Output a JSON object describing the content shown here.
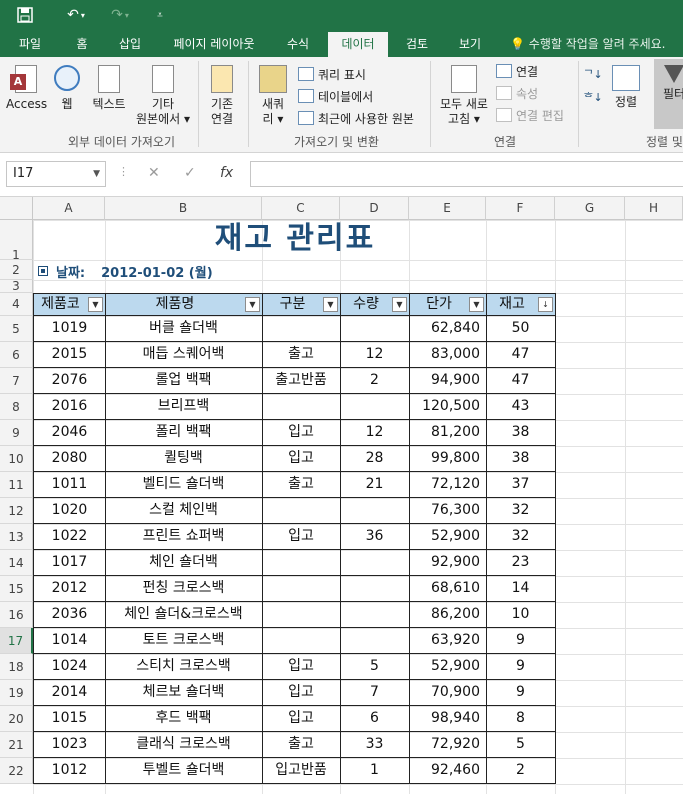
{
  "qat": {
    "save_icon": "save-icon",
    "undo_icon": "undo-icon",
    "redo_icon": "redo-icon",
    "customize_icon": "customize-qat-icon"
  },
  "tabs": [
    "파일",
    "홈",
    "삽입",
    "페이지 레이아웃",
    "수식",
    "데이터",
    "검토",
    "보기"
  ],
  "active_tab": "데이터",
  "tell_me": "수행할 작업을 알려 주세요.",
  "ribbon": {
    "external": {
      "access": "Access",
      "web": "웹",
      "text": "텍스트",
      "other_line1": "기타",
      "other_line2": "원본에서 ▾",
      "existing_line1": "기존",
      "existing_line2": "연결",
      "label": "외부 데이터 가져오기"
    },
    "get_transform": {
      "new_query_line1": "새쿼",
      "new_query_line2": "리 ▾",
      "show_queries": "쿼리 표시",
      "from_table": "테이블에서",
      "recent_sources": "최근에 사용한 원본",
      "label": "가져오기 및 변환"
    },
    "connections": {
      "refresh_line1": "모두 새로",
      "refresh_line2": "고침 ▾",
      "connections": "연결",
      "properties": "속성",
      "edit_links": "연결 편집",
      "label": "연결"
    },
    "sort_filter": {
      "sort": "정렬",
      "filter": "필터",
      "label": "정렬 및"
    }
  },
  "formula_bar": {
    "name_box": "I17",
    "fx": "fx",
    "value": ""
  },
  "columns": [
    "A",
    "B",
    "C",
    "D",
    "E",
    "F",
    "G",
    "H"
  ],
  "rows": [
    "1",
    "2",
    "3",
    "4",
    "5",
    "6",
    "7",
    "8",
    "9",
    "10",
    "11",
    "12",
    "13",
    "14",
    "15",
    "16",
    "17",
    "18",
    "19",
    "20",
    "21",
    "22"
  ],
  "selected_row": "17",
  "sheet": {
    "title": "재고 관리표",
    "date_label": "날짜:",
    "date_value": "2012-01-02 (월)",
    "headers": [
      "제품코",
      "제품명",
      "구분",
      "수량",
      "단가",
      "재고"
    ],
    "records": [
      [
        "1019",
        "버클 숄더백",
        "",
        "",
        "62,840",
        "50"
      ],
      [
        "2015",
        "매듭 스퀘어백",
        "출고",
        "12",
        "83,000",
        "47"
      ],
      [
        "2076",
        "롤업 백팩",
        "출고반품",
        "2",
        "94,900",
        "47"
      ],
      [
        "2016",
        "브리프백",
        "",
        "",
        "120,500",
        "43"
      ],
      [
        "2046",
        "폴리 백팩",
        "입고",
        "12",
        "81,200",
        "38"
      ],
      [
        "2080",
        "퀼팅백",
        "입고",
        "28",
        "99,800",
        "38"
      ],
      [
        "1011",
        "벨티드 숄더백",
        "출고",
        "21",
        "72,120",
        "37"
      ],
      [
        "1020",
        "스컬 체인백",
        "",
        "",
        "76,300",
        "32"
      ],
      [
        "1022",
        "프린트 쇼퍼백",
        "입고",
        "36",
        "52,900",
        "32"
      ],
      [
        "1017",
        "체인 숄더백",
        "",
        "",
        "92,900",
        "23"
      ],
      [
        "2012",
        "펀칭 크로스백",
        "",
        "",
        "68,610",
        "14"
      ],
      [
        "2036",
        "체인 숄더&크로스백",
        "",
        "",
        "86,200",
        "10"
      ],
      [
        "1014",
        "토트 크로스백",
        "",
        "",
        "63,920",
        "9"
      ],
      [
        "1024",
        "스티치 크로스백",
        "입고",
        "5",
        "52,900",
        "9"
      ],
      [
        "2014",
        "체르보 숄더백",
        "입고",
        "7",
        "70,900",
        "9"
      ],
      [
        "1015",
        "후드 백팩",
        "입고",
        "6",
        "98,940",
        "8"
      ],
      [
        "1023",
        "클래식 크로스백",
        "출고",
        "33",
        "72,920",
        "5"
      ],
      [
        "1012",
        "투벨트 숄더백",
        "입고반품",
        "1",
        "92,460",
        "2"
      ]
    ]
  },
  "colors": {
    "excel_green": "#217346",
    "title_blue": "#1f4e79",
    "header_fill": "#bcd9ee"
  }
}
